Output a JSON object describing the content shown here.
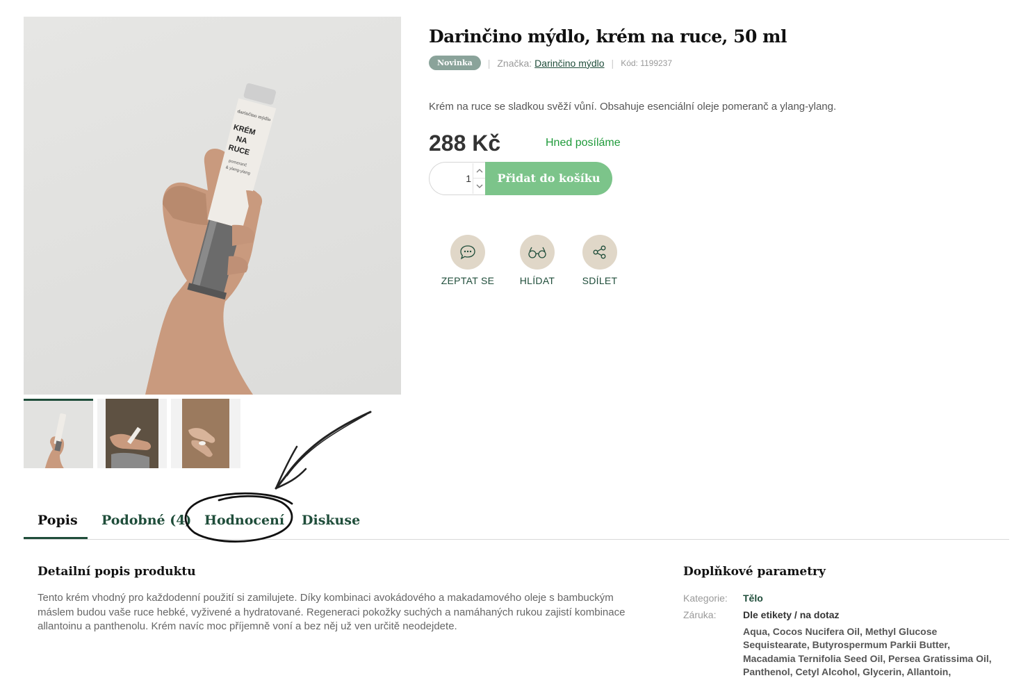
{
  "product": {
    "title": "Darinčino mýdlo, krém na ruce, 50 ml",
    "badge": "Novinka",
    "brand_label": "Značka:",
    "brand_name": "Darinčino mýdlo",
    "code": "Kód: 1199237",
    "short_description": "Krém na ruce se sladkou svěží vůní. Obsahuje esenciální oleje pomeranč a ylang-ylang.",
    "price": "288 Kč",
    "availability": "Hned posíláme",
    "quantity": "1",
    "add_to_cart": "Přidat do košíku",
    "tube_text": [
      "darinčino mýdlo",
      "KRÉM",
      "NA",
      "RUCE",
      "pomeranč",
      "& ylang-ylang"
    ]
  },
  "actions": [
    {
      "label": "ZEPTAT SE",
      "icon": "chat-icon"
    },
    {
      "label": "HLÍDAT",
      "icon": "glasses-icon"
    },
    {
      "label": "SDÍLET",
      "icon": "share-icon"
    }
  ],
  "tabs": [
    {
      "label": "Popis"
    },
    {
      "label": "Podobné (4)"
    },
    {
      "label": "Hodnocení"
    },
    {
      "label": "Diskuse"
    }
  ],
  "description": {
    "title": "Detailní popis produktu",
    "text": "Tento krém vhodný pro každodenní použití si zamilujete. Díky kombinaci avokádového a makadamového oleje s bambuckým máslem budou vaše ruce hebké, vyživené a hydratované. Regeneraci pokožky suchých a namáhaných rukou zajistí kombinace allantoinu a panthenolu. Krém navíc moc příjemně voní a bez něj už ven určitě neodejdete."
  },
  "params": {
    "title": "Doplňkové parametry",
    "category_label": "Kategorie:",
    "category_value": "Tělo",
    "warranty_label": "Záruka:",
    "warranty_value": "Dle etikety / na dotaz",
    "ingredients": "Aqua, Cocos Nucifera Oil, Methyl Glucose Sequistearate, Butyrospermum Parkii Butter, Macadamia Ternifolia Seed Oil, Persea Gratissima Oil, Panthenol, Cetyl Alcohol, Glycerin, Allantoin,"
  },
  "colors": {
    "brand_green": "#1f4d3a",
    "cart_green": "#7cc48a",
    "stock_green": "#1f9a3a",
    "icon_bg": "#e0d7c8",
    "badge_bg": "#8aa39a"
  }
}
